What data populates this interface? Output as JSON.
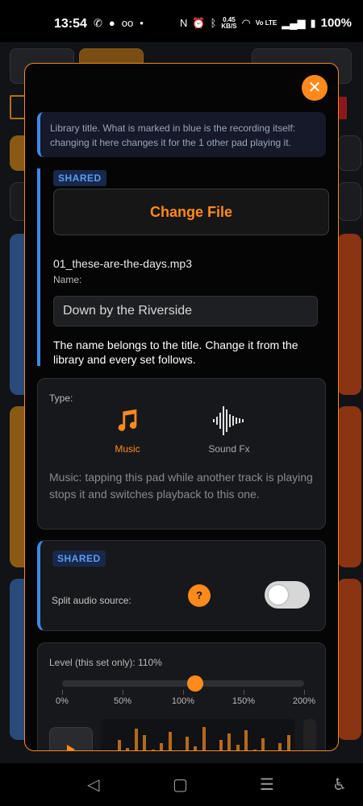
{
  "status_bar": {
    "time": "13:54",
    "net_speed_value": "0.45",
    "net_speed_unit": "KB/S",
    "volte": "Vo LTE",
    "battery": "100%"
  },
  "modal": {
    "info_text": "Library title. What is marked in blue is the recording itself: changing it here changes it for the 1 other pad playing it.",
    "shared_badge": "SHARED",
    "change_file_label": "Change File",
    "filename": "01_these-are-the-days.mp3",
    "name_label": "Name:",
    "name_value": "Down by the Riverside",
    "name_note": "The name belongs to the title. Change it from the library and every set follows.",
    "type": {
      "label": "Type:",
      "options": [
        {
          "label": "Music",
          "selected": true
        },
        {
          "label": "Sound Fx",
          "selected": false
        }
      ],
      "description": "Music: tapping this pad while another track is playing stops it and switches playback to this one."
    },
    "split": {
      "badge": "SHARED",
      "label": "Split audio source:",
      "help": "?",
      "enabled": false
    },
    "level": {
      "label": "Level (this set only): 110%",
      "value_percent": 110,
      "min": 0,
      "max": 200,
      "ticks": [
        "0%",
        "50%",
        "100%",
        "150%",
        "200%"
      ]
    }
  },
  "colors": {
    "accent": "#ff8a1c",
    "shared_blue": "#3f88e8"
  }
}
